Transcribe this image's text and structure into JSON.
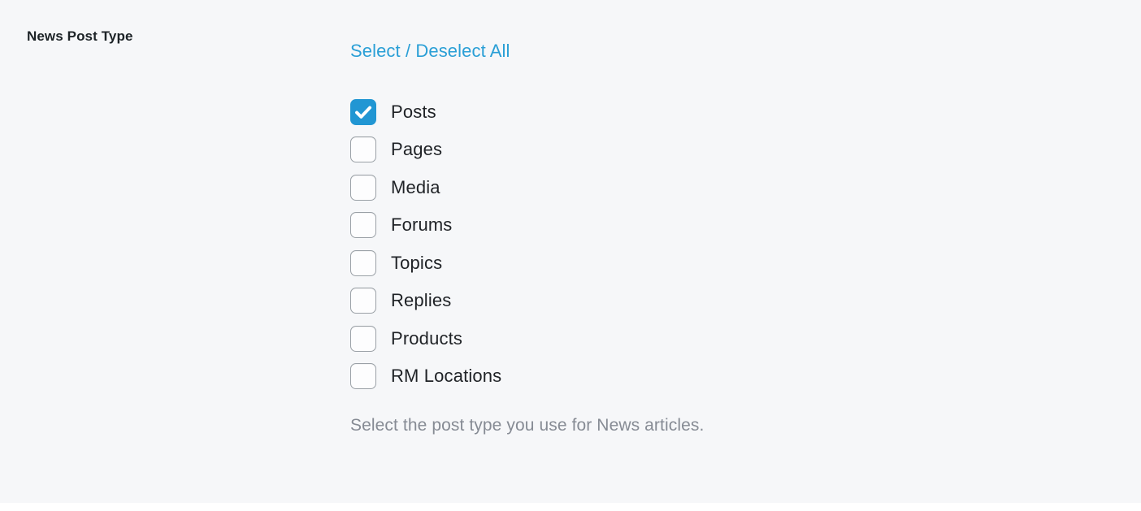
{
  "panel": {
    "background_color": "#f6f7f9",
    "page_background_color": "#ffffff"
  },
  "field": {
    "label": "News Post Type",
    "description": "Select the post type you use for News articles.",
    "select_all": {
      "label": "Select / Deselect All",
      "color": "#2a9fd6"
    },
    "accent_color": "#2196d3",
    "options": [
      {
        "label": "Posts",
        "checked": true
      },
      {
        "label": "Pages",
        "checked": false
      },
      {
        "label": "Media",
        "checked": false
      },
      {
        "label": "Forums",
        "checked": false
      },
      {
        "label": "Topics",
        "checked": false
      },
      {
        "label": "Replies",
        "checked": false
      },
      {
        "label": "Products",
        "checked": false
      },
      {
        "label": "RM Locations",
        "checked": false
      }
    ]
  }
}
